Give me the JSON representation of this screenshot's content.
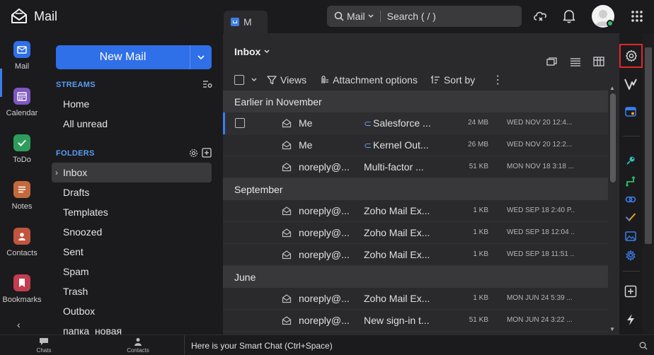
{
  "app": {
    "name": "Mail"
  },
  "tab": {
    "label": "M"
  },
  "search": {
    "scope": "Mail",
    "placeholder": "Search ( / )"
  },
  "rail": {
    "items": [
      {
        "label": "Mail",
        "color": "#2f6fe8",
        "icon": "mail-icon"
      },
      {
        "label": "Calendar",
        "color": "#7e57c2",
        "icon": "calendar-icon"
      },
      {
        "label": "ToDo",
        "color": "#2e9d5b",
        "icon": "todo-icon"
      },
      {
        "label": "Notes",
        "color": "#c2693d",
        "icon": "notes-icon"
      },
      {
        "label": "Contacts",
        "color": "#c2553d",
        "icon": "contacts-icon"
      },
      {
        "label": "Bookmarks",
        "color": "#c23d4f",
        "icon": "bookmarks-icon"
      }
    ],
    "collapse": "‹"
  },
  "folders_panel": {
    "new_mail": "New Mail",
    "streams_title": "STREAMS",
    "streams": [
      "Home",
      "All unread"
    ],
    "folders_title": "FOLDERS",
    "folders": [
      "Inbox",
      "Drafts",
      "Templates",
      "Snoozed",
      "Sent",
      "Spam",
      "Trash",
      "Outbox",
      "папка_новая"
    ],
    "active_folder": "Inbox"
  },
  "list": {
    "title": "Inbox",
    "toolbar": {
      "views": "Views",
      "attachment": "Attachment options",
      "sort": "Sort by"
    },
    "groups": [
      {
        "label": "Earlier in November",
        "rows": [
          {
            "from": "Me",
            "subject": "Salesforce ...",
            "attachment": true,
            "size": "24 MB",
            "date": "WED NOV 20 12:4..."
          },
          {
            "from": "Me",
            "subject": "Kernel Out...",
            "attachment": true,
            "size": "26 MB",
            "date": "WED NOV 20 12:2..."
          },
          {
            "from": "noreply@...",
            "subject": "Multi-factor ...",
            "attachment": false,
            "size": "51 KB",
            "date": "MON NOV 18 3:18 ..."
          }
        ]
      },
      {
        "label": "September",
        "rows": [
          {
            "from": "noreply@...",
            "subject": "Zoho Mail Ex...",
            "attachment": false,
            "size": "1 KB",
            "date": "WED SEP 18 2:40 P..."
          },
          {
            "from": "noreply@...",
            "subject": "Zoho Mail Ex...",
            "attachment": false,
            "size": "1 KB",
            "date": "WED SEP 18 12:04 ..."
          },
          {
            "from": "noreply@...",
            "subject": "Zoho Mail Ex...",
            "attachment": false,
            "size": "1 KB",
            "date": "WED SEP 18 11:51 ..."
          }
        ]
      },
      {
        "label": "June",
        "rows": [
          {
            "from": "noreply@...",
            "subject": "Zoho Mail Ex...",
            "attachment": false,
            "size": "1 KB",
            "date": "MON JUN 24 5:39 ..."
          },
          {
            "from": "noreply@...",
            "subject": "New sign-in t...",
            "attachment": false,
            "size": "51 KB",
            "date": "MON JUN 24 3:22 ..."
          }
        ]
      }
    ]
  },
  "bottom": {
    "chats": "Chats",
    "contacts": "Contacts",
    "smart_chat": "Here is your Smart Chat (Ctrl+Space)"
  },
  "colors": {
    "accent": "#2f6fe8",
    "highlight_box": "#e0262d",
    "online": "#2fbf6f"
  }
}
